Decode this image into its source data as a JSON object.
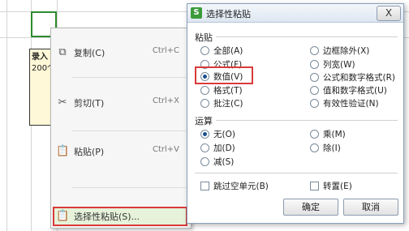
{
  "spreadsheet": {
    "note_title": "录入",
    "note_text": "200个"
  },
  "context_menu": {
    "items": [
      {
        "icon": "copy-icon",
        "label": "复制(C)",
        "shortcut": "Ctrl+C"
      },
      {
        "icon": "cut-icon",
        "label": "剪切(T)",
        "shortcut": "Ctrl+X"
      },
      {
        "icon": "paste-icon",
        "label": "粘贴(P)",
        "shortcut": "Ctrl+V"
      },
      {
        "icon": "paste-special-icon",
        "label": "选择性粘贴(S)...",
        "shortcut": ""
      }
    ]
  },
  "dialog": {
    "logo": "S",
    "title": "选择性粘贴",
    "close": "X",
    "paste_section": "粘贴",
    "paste_options": [
      {
        "label": "全部(A)",
        "selected": false
      },
      {
        "label": "边框除外(X)",
        "selected": false
      },
      {
        "label": "公式(F)",
        "selected": false
      },
      {
        "label": "列宽(W)",
        "selected": false
      },
      {
        "label": "数值(V)",
        "selected": true
      },
      {
        "label": "公式和数字格式(R)",
        "selected": false
      },
      {
        "label": "格式(T)",
        "selected": false
      },
      {
        "label": "值和数字格式(U)",
        "selected": false
      },
      {
        "label": "批注(C)",
        "selected": false
      },
      {
        "label": "有效性验证(N)",
        "selected": false
      }
    ],
    "operation_section": "运算",
    "operation_options": [
      {
        "label": "无(O)",
        "selected": true
      },
      {
        "label": "乘(M)",
        "selected": false
      },
      {
        "label": "加(D)",
        "selected": false
      },
      {
        "label": "除(I)",
        "selected": false
      },
      {
        "label": "减(S)",
        "selected": false
      }
    ],
    "skip_blanks": "跳过空单元(B)",
    "transpose": "转置(E)",
    "ok": "确定",
    "cancel": "取消"
  },
  "colors": {
    "highlight": "#d93a3a",
    "selection": "#2e8b2e"
  }
}
